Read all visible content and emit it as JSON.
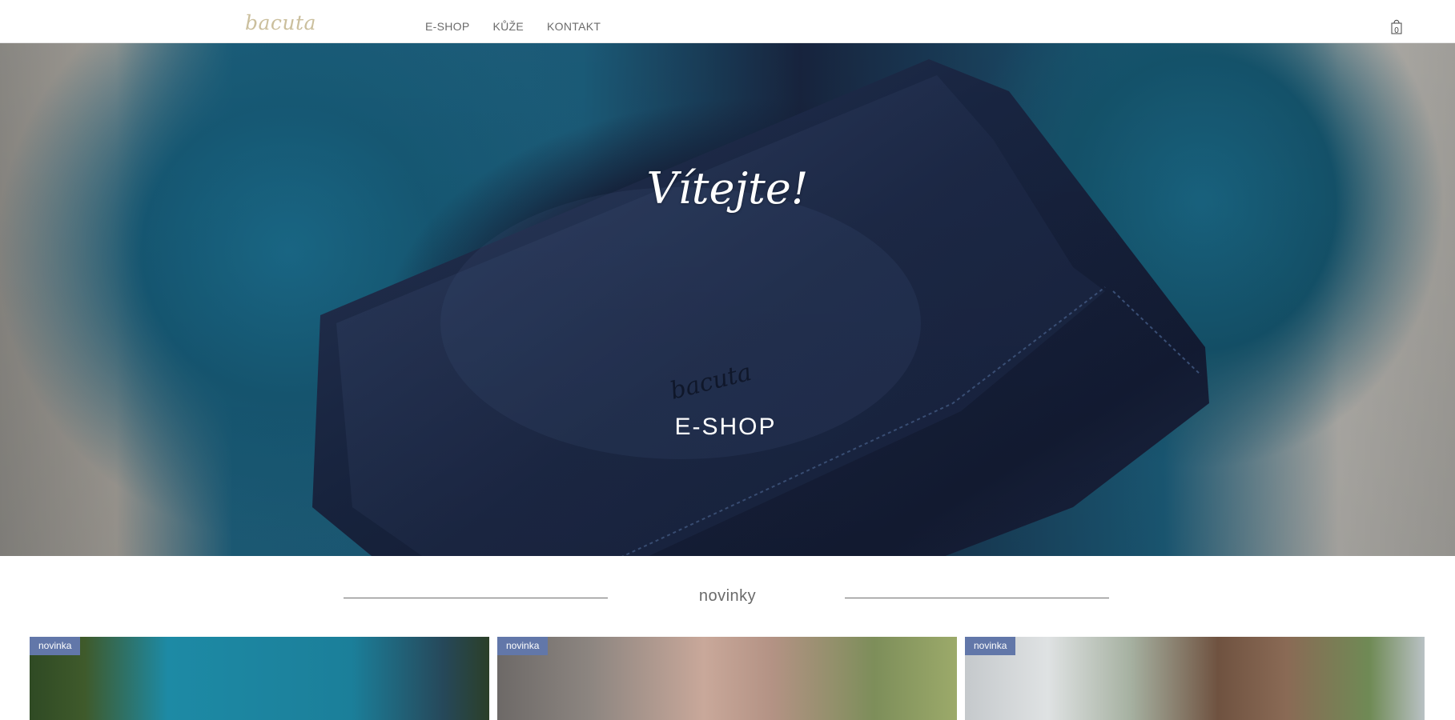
{
  "header": {
    "logo": "bacuta",
    "nav": [
      {
        "label": "E-SHOP"
      },
      {
        "label": "KŮŽE"
      },
      {
        "label": "KONTAKT"
      }
    ],
    "cart_count": "0",
    "cart_icon": "shopping-bag-icon"
  },
  "hero": {
    "title": "Vítejte!",
    "cta": "E-SHOP",
    "bag_emboss": "bacuta"
  },
  "section": {
    "title": "novinky"
  },
  "products": [
    {
      "badge": "novinka"
    },
    {
      "badge": "novinka"
    },
    {
      "badge": "novinka"
    }
  ],
  "colors": {
    "logo": "#cbbf9d",
    "badge": "#6277a9",
    "nav_text": "#6b6b6b"
  }
}
